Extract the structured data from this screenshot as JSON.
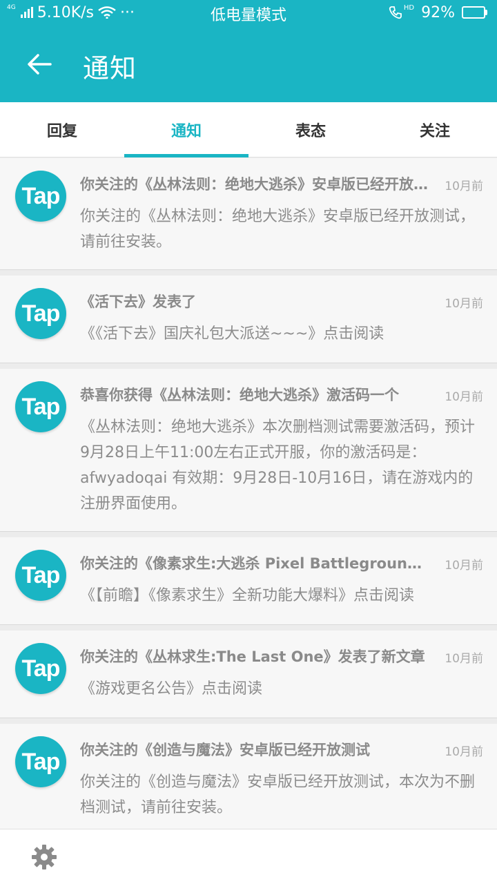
{
  "status_bar": {
    "network_type": "4G",
    "speed": "5.10K/s",
    "more": "···",
    "mode": "低电量模式",
    "hd_label": "HD",
    "battery": "92%",
    "battery_level": 0.92
  },
  "header": {
    "title": "通知"
  },
  "tabs": [
    {
      "label": "回复",
      "active": false
    },
    {
      "label": "通知",
      "active": true
    },
    {
      "label": "表态",
      "active": false
    },
    {
      "label": "关注",
      "active": false
    }
  ],
  "avatar_text": "Tap",
  "notifications": [
    {
      "title": "你关注的《丛林法则：绝地大逃杀》安卓版已经开放测试",
      "time": "10月前",
      "body": "你关注的《丛林法则：绝地大逃杀》安卓版已经开放测试，请前往安装。"
    },
    {
      "title": "《活下去》发表了",
      "time": "10月前",
      "body": "《《活下去》国庆礼包大派送~~~》点击阅读"
    },
    {
      "title": "恭喜你获得《丛林法则：绝地大逃杀》激活码一个",
      "time": "10月前",
      "body": "《丛林法则：绝地大逃杀》本次删档测试需要激活码，预计9月28日上午11:00左右正式开服，你的激活码是：afwyadoqai 有效期：9月28日-10月16日，请在游戏内的注册界面使用。"
    },
    {
      "title": "你关注的《像素求生:大逃杀  Pixel Battlegrounds》",
      "time": "10月前",
      "body": "《【前瞻】《像素求生》全新功能大爆料》点击阅读"
    },
    {
      "title": "你关注的《丛林求生:The Last One》发表了新文章",
      "time": "10月前",
      "body": "《游戏更名公告》点击阅读"
    },
    {
      "title": "你关注的《创造与魔法》安卓版已经开放测试",
      "time": "10月前",
      "body": "你关注的《创造与魔法》安卓版已经开放测试，本次为不删档测试，请前往安装。"
    }
  ]
}
